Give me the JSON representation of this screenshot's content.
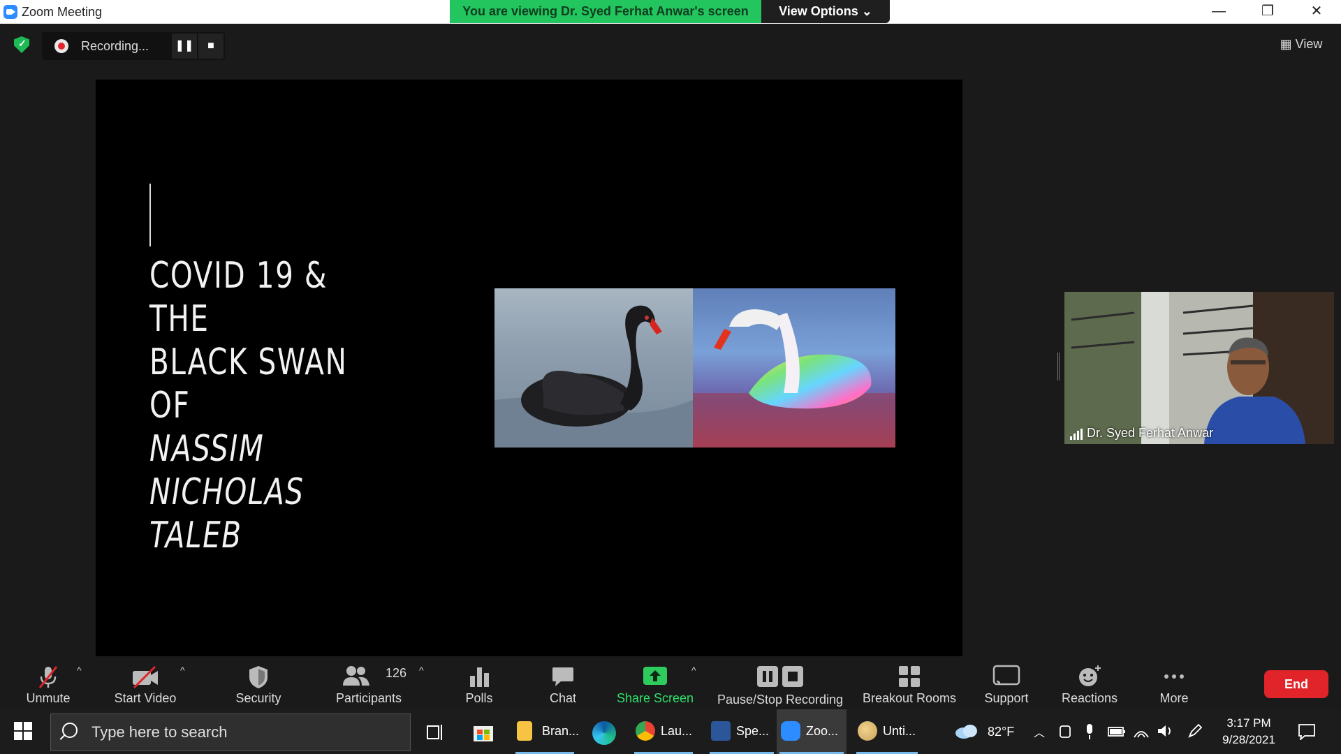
{
  "window": {
    "title": "Zoom Meeting",
    "share_banner": "You are viewing Dr. Syed Ferhat Anwar's screen",
    "view_options": "View Options ⌄",
    "minimize": "—",
    "restore": "❐",
    "close": "✕"
  },
  "top": {
    "recording_label": "Recording...",
    "pause": "❚❚",
    "stop": "■",
    "view_label": "▦ View"
  },
  "slide": {
    "title_line1": "COVID 19 & THE",
    "title_line2": "BLACK SWAN OF",
    "title_line3": "NASSIM",
    "title_line4": "NICHOLAS",
    "title_line5": "TALEB"
  },
  "participant": {
    "name": "Dr. Syed Ferhat Anwar"
  },
  "toolbar": {
    "unmute": "Unmute",
    "start_video": "Start Video",
    "security": "Security",
    "participants": "Participants",
    "participants_count": "126",
    "polls": "Polls",
    "chat": "Chat",
    "share_screen": "Share Screen",
    "pause_stop_recording": "Pause/Stop Recording",
    "breakout_rooms": "Breakout Rooms",
    "support": "Support",
    "reactions": "Reactions",
    "more": "More",
    "end": "End",
    "caret": "^"
  },
  "taskbar": {
    "search_placeholder": "Type here to search",
    "apps": [
      {
        "label": "Bran..."
      },
      {
        "label": "Lau..."
      },
      {
        "label": "Spe..."
      },
      {
        "label": "Zoo..."
      },
      {
        "label": "Unti..."
      }
    ],
    "weather": "82°F",
    "time": "3:17 PM",
    "date": "9/28/2021"
  },
  "colors": {
    "share_green": "#23c55e",
    "end_red": "#e0242a",
    "taskbar_bg": "#1c1c1c",
    "app_bg": "#1a1a1a"
  }
}
